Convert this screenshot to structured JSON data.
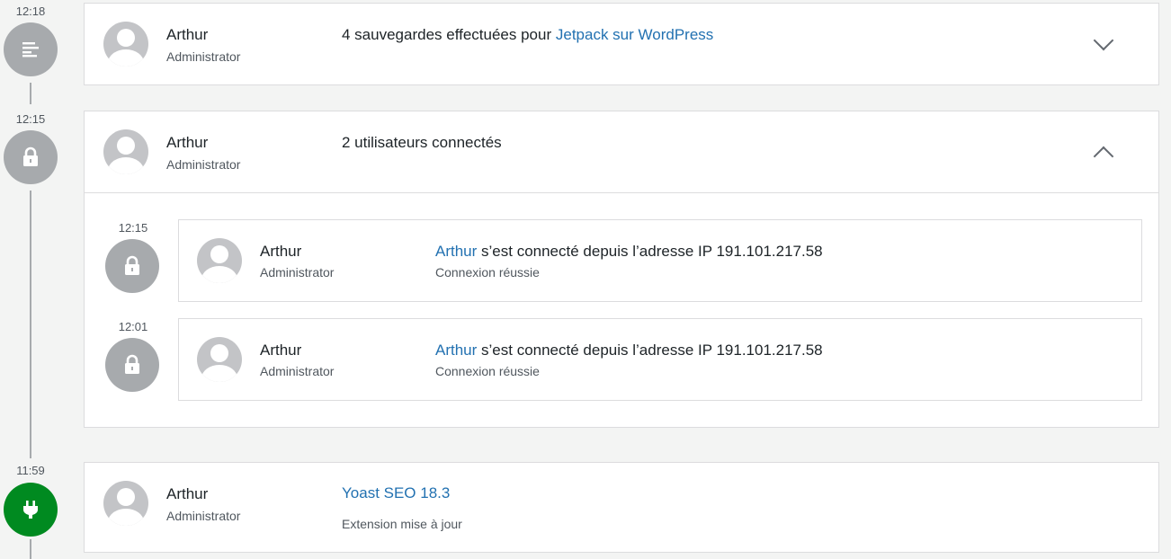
{
  "events": [
    {
      "time": "12:18",
      "icon": "activity-log-icon",
      "user": "Arthur",
      "role": "Administrator",
      "message_prefix": "4 sauvegardes effectuées pour ",
      "message_link": "Jetpack sur WordPress",
      "expanded": false
    },
    {
      "time": "12:15",
      "icon": "lock-icon",
      "user": "Arthur",
      "role": "Administrator",
      "message": "2 utilisateurs connectés",
      "expanded": true,
      "children": [
        {
          "time": "12:15",
          "user": "Arthur",
          "role": "Administrator",
          "message_link": "Arthur",
          "message_suffix": " s’est connecté depuis l’adresse IP 191.101.217.58",
          "status": "Connexion réussie"
        },
        {
          "time": "12:01",
          "user": "Arthur",
          "role": "Administrator",
          "message_link": "Arthur",
          "message_suffix": " s’est connecté depuis l’adresse IP 191.101.217.58",
          "status": "Connexion réussie"
        }
      ]
    },
    {
      "time": "11:59",
      "icon": "plugin-icon",
      "user": "Arthur",
      "role": "Administrator",
      "message_link": "Yoast SEO 18.3",
      "status": "Extension mise à jour",
      "expanded": false
    }
  ],
  "colors": {
    "link": "#2271b1",
    "icon_grey": "#a7aaad",
    "icon_green": "#008a20"
  }
}
